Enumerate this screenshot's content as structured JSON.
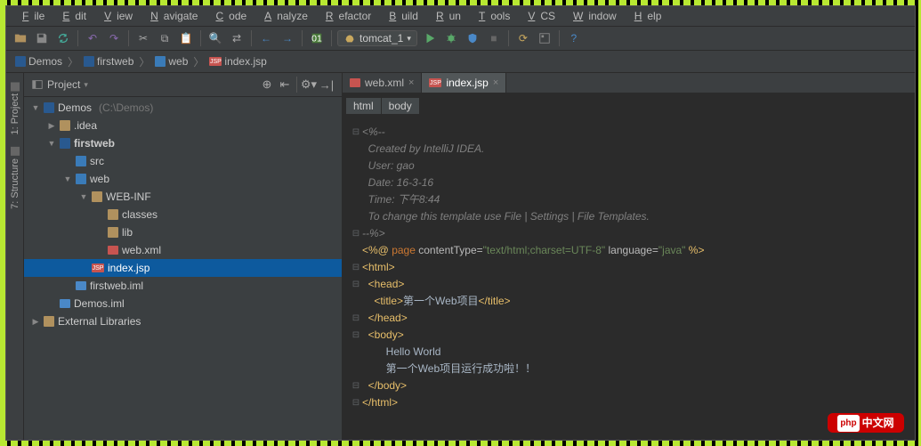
{
  "menu": [
    "File",
    "Edit",
    "View",
    "Navigate",
    "Code",
    "Analyze",
    "Refactor",
    "Build",
    "Run",
    "Tools",
    "VCS",
    "Window",
    "Help"
  ],
  "run_config": "tomcat_1",
  "breadcrumb": [
    {
      "icon": "folder-open",
      "label": "Demos"
    },
    {
      "icon": "folder-open",
      "label": "firstweb"
    },
    {
      "icon": "folder-web",
      "label": "web"
    },
    {
      "icon": "jsp",
      "label": "index.jsp"
    }
  ],
  "panel": {
    "title": "Project"
  },
  "side_tabs": [
    "1: Project",
    "7: Structure"
  ],
  "tree": [
    {
      "indent": 0,
      "arrow": "▼",
      "icon": "folder-open",
      "label": "Demos",
      "hint": "(C:\\Demos)"
    },
    {
      "indent": 1,
      "arrow": "▶",
      "icon": "folder",
      "label": ".idea"
    },
    {
      "indent": 1,
      "arrow": "▼",
      "icon": "folder-open",
      "label": "firstweb",
      "bold": true
    },
    {
      "indent": 2,
      "arrow": "",
      "icon": "folder-web",
      "label": "src"
    },
    {
      "indent": 2,
      "arrow": "▼",
      "icon": "folder-web",
      "label": "web"
    },
    {
      "indent": 3,
      "arrow": "▼",
      "icon": "folder",
      "label": "WEB-INF"
    },
    {
      "indent": 4,
      "arrow": "",
      "icon": "folder",
      "label": "classes"
    },
    {
      "indent": 4,
      "arrow": "",
      "icon": "folder",
      "label": "lib"
    },
    {
      "indent": 4,
      "arrow": "",
      "icon": "xml",
      "label": "web.xml"
    },
    {
      "indent": 3,
      "arrow": "",
      "icon": "jsp",
      "label": "index.jsp",
      "selected": true
    },
    {
      "indent": 2,
      "arrow": "",
      "icon": "iml",
      "label": "firstweb.iml"
    },
    {
      "indent": 1,
      "arrow": "",
      "icon": "iml",
      "label": "Demos.iml"
    },
    {
      "indent": 0,
      "arrow": "▶",
      "icon": "lib",
      "label": "External Libraries"
    }
  ],
  "editor_tabs": [
    {
      "icon": "xml",
      "label": "web.xml",
      "active": false
    },
    {
      "icon": "jsp",
      "label": "index.jsp",
      "active": true
    }
  ],
  "html_crumbs": [
    "html",
    "body"
  ],
  "code_lines": [
    {
      "g": "⊟",
      "segs": [
        {
          "cls": "c-comment",
          "t": "<%--"
        }
      ]
    },
    {
      "g": "",
      "segs": [
        {
          "cls": "c-comment",
          "t": "  Created by IntelliJ IDEA."
        }
      ]
    },
    {
      "g": "",
      "segs": [
        {
          "cls": "c-comment",
          "t": "  User: gao"
        }
      ]
    },
    {
      "g": "",
      "segs": [
        {
          "cls": "c-comment",
          "t": "  Date: 16-3-16"
        }
      ]
    },
    {
      "g": "",
      "segs": [
        {
          "cls": "c-comment",
          "t": "  Time: 下午8:44"
        }
      ]
    },
    {
      "g": "",
      "segs": [
        {
          "cls": "c-comment",
          "t": "  To change this template use File | Settings | File Templates."
        }
      ]
    },
    {
      "g": "⊟",
      "segs": [
        {
          "cls": "c-comment",
          "t": "--%>"
        }
      ]
    },
    {
      "g": "",
      "segs": [
        {
          "cls": "c-tag",
          "t": "<%@ "
        },
        {
          "cls": "c-kw",
          "t": "page "
        },
        {
          "cls": "c-attr",
          "t": "contentType="
        },
        {
          "cls": "c-str",
          "t": "\"text/html;charset=UTF-8\" "
        },
        {
          "cls": "c-attr",
          "t": "language="
        },
        {
          "cls": "c-str",
          "t": "\"java\" "
        },
        {
          "cls": "c-tag",
          "t": "%>"
        }
      ]
    },
    {
      "g": "⊟",
      "segs": [
        {
          "cls": "c-tag",
          "t": "<html>"
        }
      ]
    },
    {
      "g": "⊟",
      "segs": [
        {
          "cls": "c-text",
          "t": "  "
        },
        {
          "cls": "c-tag",
          "t": "<head>"
        }
      ]
    },
    {
      "g": "",
      "segs": [
        {
          "cls": "c-text",
          "t": "    "
        },
        {
          "cls": "c-tag",
          "t": "<title>"
        },
        {
          "cls": "c-text",
          "t": "第一个Web项目"
        },
        {
          "cls": "c-tag",
          "t": "</title>"
        }
      ]
    },
    {
      "g": "⊟",
      "segs": [
        {
          "cls": "c-text",
          "t": "  "
        },
        {
          "cls": "c-tag",
          "t": "</head>"
        }
      ]
    },
    {
      "g": "⊟",
      "segs": [
        {
          "cls": "c-text",
          "t": "  "
        },
        {
          "cls": "c-tag",
          "t": "<body>"
        }
      ]
    },
    {
      "g": "",
      "segs": [
        {
          "cls": "c-text",
          "t": "        Hello World"
        }
      ]
    },
    {
      "g": "",
      "segs": [
        {
          "cls": "c-text",
          "t": "        第一个Web项目运行成功啦！！"
        }
      ]
    },
    {
      "g": "⊟",
      "segs": [
        {
          "cls": "c-text",
          "t": "  "
        },
        {
          "cls": "c-tag",
          "t": "</body>"
        }
      ]
    },
    {
      "g": "⊟",
      "segs": [
        {
          "cls": "c-tag",
          "t": "</html>"
        }
      ]
    }
  ],
  "watermark": "中文网"
}
